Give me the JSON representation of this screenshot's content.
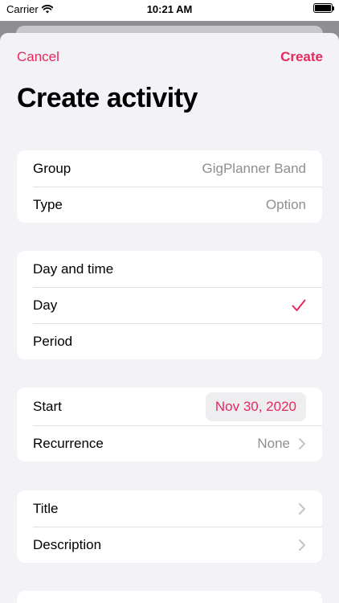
{
  "status": {
    "carrier": "Carrier",
    "time": "10:21 AM"
  },
  "nav": {
    "cancel": "Cancel",
    "create": "Create"
  },
  "title": "Create activity",
  "group1": {
    "group_label": "Group",
    "group_value": "GigPlanner Band",
    "type_label": "Type",
    "type_value": "Option"
  },
  "group2": {
    "header": "Day and time",
    "day": "Day",
    "period": "Period"
  },
  "group3": {
    "start_label": "Start",
    "start_value": "Nov 30, 2020",
    "recurrence_label": "Recurrence",
    "recurrence_value": "None"
  },
  "group4": {
    "title_label": "Title",
    "description_label": "Description"
  },
  "colors": {
    "accent": "#e5295e",
    "secondary_text": "#8e8e93",
    "background": "#f2f2f7"
  },
  "icons": [
    "wifi-icon",
    "battery-icon",
    "checkmark-icon",
    "chevron-right-icon"
  ]
}
